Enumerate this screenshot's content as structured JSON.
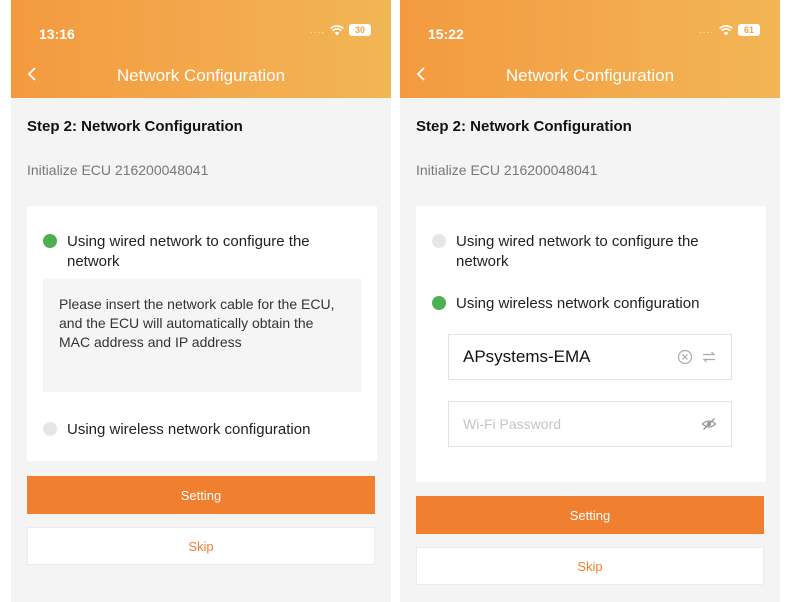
{
  "screens": [
    {
      "status_time": "13:16",
      "signal": "....",
      "battery": "30",
      "nav_title": "Network Configuration",
      "step_title": "Step 2: Network Configuration",
      "ecu_text": "Initialize ECU 216200048041",
      "option_wired": "Using wired network to configure the network",
      "wired_info": "Please insert the network cable for the ECU, and the ECU will automatically obtain the MAC address and IP address",
      "option_wireless": "Using wireless network configuration",
      "setting_label": "Setting",
      "skip_label": "Skip",
      "selected": "wired"
    },
    {
      "status_time": "15:22",
      "signal": "....",
      "battery": "61",
      "nav_title": "Network Configuration",
      "step_title": "Step 2: Network Configuration",
      "ecu_text": "Initialize ECU 216200048041",
      "option_wired": "Using wired network to configure the network",
      "option_wireless": "Using wireless network configuration",
      "ssid_value": "APsystems-EMA",
      "password_placeholder": "Wi-Fi Password",
      "setting_label": "Setting",
      "skip_label": "Skip",
      "selected": "wireless"
    }
  ],
  "colors": {
    "accent": "#f07f2f",
    "header_start": "#f39a3f",
    "header_end": "#f2b654",
    "radio_selected": "#4caf50",
    "radio_unselected": "#e6e6e6"
  },
  "icons": [
    "back-chevron-icon",
    "wifi-icon",
    "battery-icon",
    "clear-icon",
    "switch-network-icon",
    "hide-password-icon"
  ]
}
